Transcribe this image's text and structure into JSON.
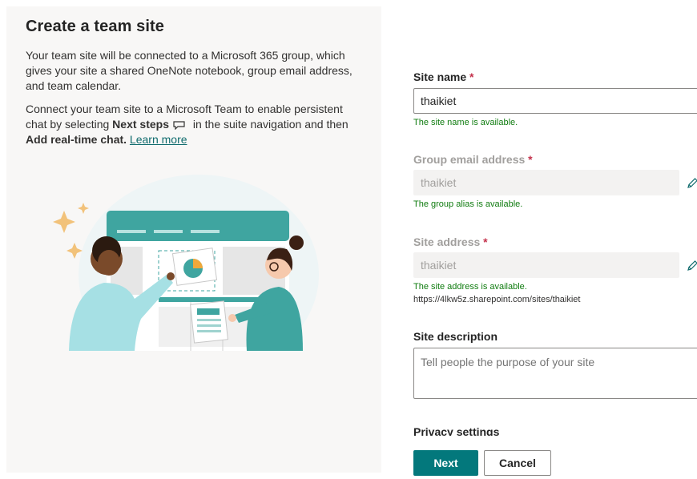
{
  "panel": {
    "title": "Create a team site",
    "para1": "Your team site will be connected to a Microsoft 365 group, which gives your site a shared OneNote notebook, group email address, and team calendar.",
    "para2_prefix": "Connect your team site to a Microsoft Team to enable persistent chat by selecting ",
    "para2_bold1": "Next steps",
    "para2_middle": " in the suite navigation and then ",
    "para2_bold2": "Add real-time chat.",
    "learn_more": "Learn more"
  },
  "form": {
    "site_name": {
      "label": "Site name",
      "required": "*",
      "value": "thaikiet",
      "status": "The site name is available."
    },
    "group_email": {
      "label": "Group email address",
      "required": "*",
      "value": "thaikiet",
      "status": "The group alias is available."
    },
    "site_address": {
      "label": "Site address",
      "required": "*",
      "value": "thaikiet",
      "status": "The site address is available.",
      "url": "https://4lkw5z.sharepoint.com/sites/thaikiet"
    },
    "site_description": {
      "label": "Site description",
      "placeholder": "Tell people the purpose of your site"
    },
    "privacy_label": "Privacy settings"
  },
  "buttons": {
    "next": "Next",
    "cancel": "Cancel"
  },
  "colors": {
    "accent": "#03787c",
    "success": "#107c10",
    "required": "#c4314b"
  }
}
